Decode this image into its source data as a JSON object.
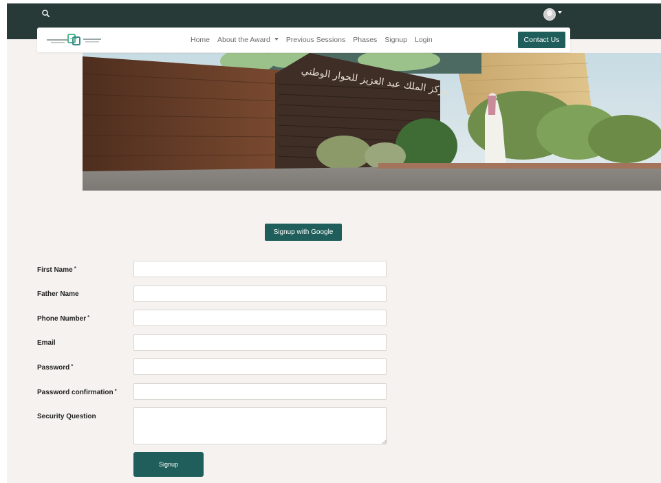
{
  "topbar": {
    "search_icon": "search-icon",
    "avatar_icon": "user-avatar-icon",
    "caret_icon": "chevron-down-icon"
  },
  "navbar": {
    "logo_icon": "national-dialogue-logo",
    "links": [
      "Home",
      "About the Award",
      "Previous Sessions",
      "Phases",
      "Signup",
      "Login"
    ],
    "contact_label": "Contact Us"
  },
  "hero": {
    "building_sign": "مركز الملك عبد العزيز للحوار الوطني"
  },
  "auth": {
    "google_label": "Signup with Google"
  },
  "form": {
    "first_name": {
      "label": "First Name",
      "required": "*",
      "value": ""
    },
    "father_name": {
      "label": "Father Name",
      "value": ""
    },
    "phone_number": {
      "label": "Phone Number",
      "required": "*",
      "value": ""
    },
    "email": {
      "label": "Email",
      "value": ""
    },
    "password": {
      "label": "Password",
      "required": "*",
      "value": ""
    },
    "password_confirmation": {
      "label": "Password confirmation",
      "required": "*",
      "value": ""
    },
    "security_question": {
      "label": "Security Question",
      "value": ""
    },
    "submit_label": "Signup"
  },
  "colors": {
    "topbar": "#273a38",
    "accent": "#1f5e5a",
    "page_background": "#f5f2ef"
  }
}
